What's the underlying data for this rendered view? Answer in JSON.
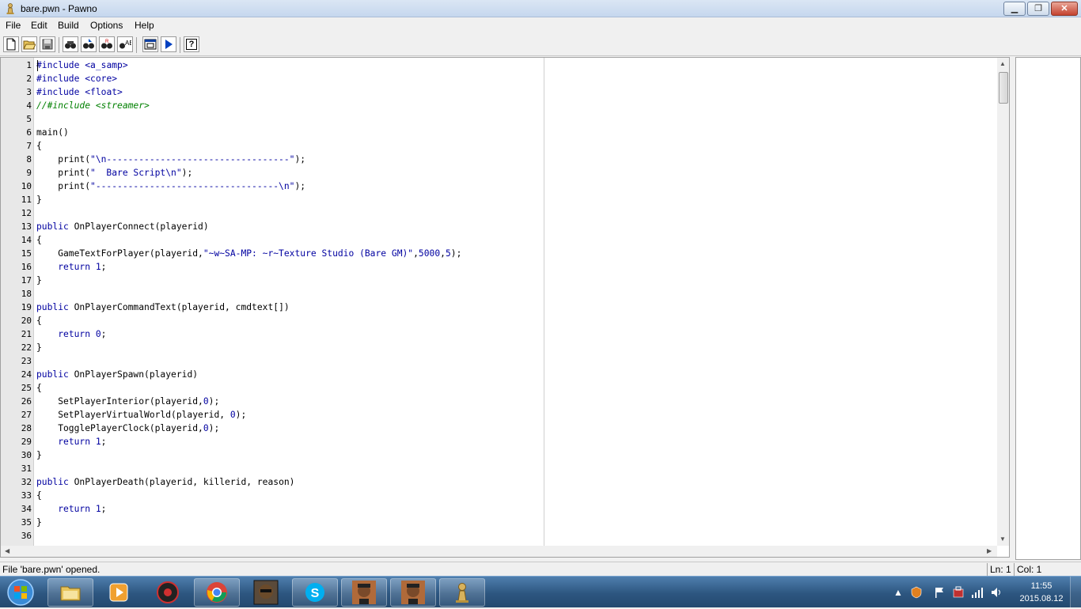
{
  "window": {
    "title": "bare.pwn - Pawno",
    "min_glyph": "▁",
    "max_glyph": "❐",
    "close_glyph": "✕"
  },
  "menu": [
    "File",
    "Edit",
    "Build",
    "Options",
    "Help"
  ],
  "toolbar": {
    "buttons": [
      "new-file-icon",
      "open-file-icon",
      "save-file-icon",
      "find-icon",
      "find-next-icon",
      "replace-icon",
      "goto-line-icon",
      "new-include-icon",
      "compile-run-icon",
      "help-icon"
    ],
    "help_glyph": "?"
  },
  "editor": {
    "line_numbers": [
      "1",
      "2",
      "3",
      "4",
      "5",
      "6",
      "7",
      "8",
      "9",
      "10",
      "11",
      "12",
      "13",
      "14",
      "15",
      "16",
      "17",
      "18",
      "19",
      "20",
      "21",
      "22",
      "23",
      "24",
      "25",
      "26",
      "27",
      "28",
      "29",
      "30",
      "31",
      "32",
      "33",
      "34",
      "35",
      "36"
    ],
    "lines": [
      "#include <a_samp>",
      "#include <core>",
      "#include <float>",
      "//#include <streamer>",
      "",
      "main()",
      "{",
      "    print(\"\\n----------------------------------\");",
      "    print(\"  Bare Script\\n\");",
      "    print(\"----------------------------------\\n\");",
      "}",
      "",
      "public OnPlayerConnect(playerid)",
      "{",
      "    GameTextForPlayer(playerid,\"~w~SA-MP: ~r~Texture Studio (Bare GM)\",5000,5);",
      "    return 1;",
      "}",
      "",
      "public OnPlayerCommandText(playerid, cmdtext[])",
      "{",
      "    return 0;",
      "}",
      "",
      "public OnPlayerSpawn(playerid)",
      "{",
      "    SetPlayerInterior(playerid,0);",
      "    SetPlayerVirtualWorld(playerid, 0);",
      "    TogglePlayerClock(playerid,0);",
      "    return 1;",
      "}",
      "",
      "public OnPlayerDeath(playerid, killerid, reason)",
      "{",
      "    return 1;",
      "}",
      ""
    ]
  },
  "status": {
    "message": "File 'bare.pwn' opened.",
    "line": "Ln: 1",
    "col": "Col: 1"
  },
  "taskbar": {
    "apps": [
      "explorer-icon",
      "media-player-icon",
      "app-icon",
      "chrome-icon",
      "gta-sa-icon",
      "skype-icon",
      "samp-icon",
      "samp-icon-2",
      "pawno-icon"
    ],
    "tray_arrow": "▲",
    "time": "11:55",
    "date": "2015.08.12"
  },
  "colors": {
    "keyword": "#0000a0",
    "comment": "#008000",
    "gutter": "#e8e8e8",
    "taskbar": "#2d5680"
  }
}
